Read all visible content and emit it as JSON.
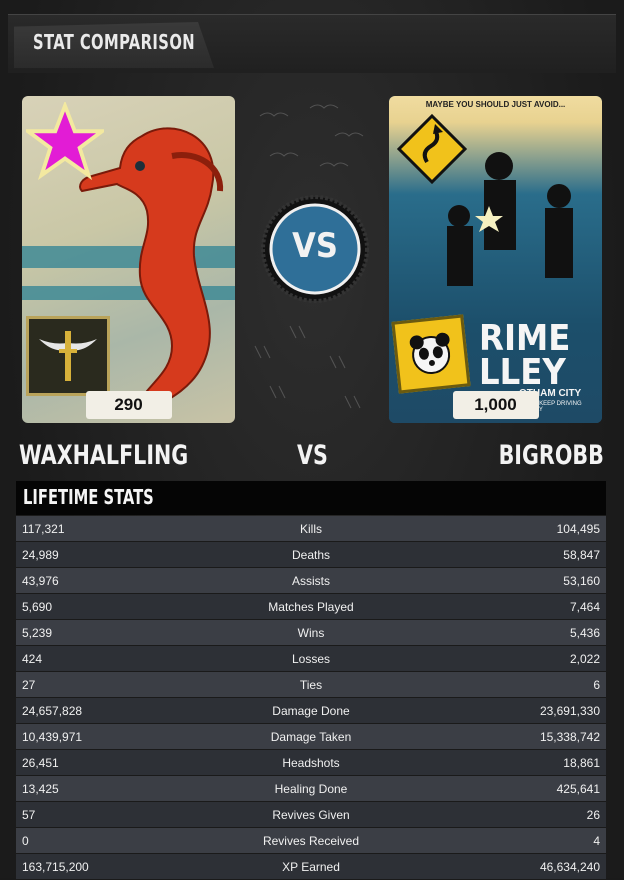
{
  "header": {
    "title": "STAT COMPARISON"
  },
  "player_left": {
    "name": "WAXHALFLING",
    "score": "290",
    "card_art": "red seahorse card",
    "badge": "winged sword"
  },
  "versus": {
    "label": "VS",
    "badge_text": "VS"
  },
  "player_right": {
    "name": "BIGROBB",
    "score": "1,000",
    "card_art": "crime alley poster",
    "poster_top": "MAYBE YOU SHOULD JUST AVOID...",
    "poster_word1": "RIME",
    "poster_word2": "LLEY",
    "poster_sub": "OTHAM CITY",
    "poster_small": "BUT JUST KEEP DRIVING SERIOUSLY"
  },
  "stats": {
    "title": "LIFETIME STATS",
    "rows": [
      {
        "left": "117,321",
        "label": "Kills",
        "right": "104,495"
      },
      {
        "left": "24,989",
        "label": "Deaths",
        "right": "58,847"
      },
      {
        "left": "43,976",
        "label": "Assists",
        "right": "53,160"
      },
      {
        "left": "5,690",
        "label": "Matches Played",
        "right": "7,464"
      },
      {
        "left": "5,239",
        "label": "Wins",
        "right": "5,436"
      },
      {
        "left": "424",
        "label": "Losses",
        "right": "2,022"
      },
      {
        "left": "27",
        "label": "Ties",
        "right": "6"
      },
      {
        "left": "24,657,828",
        "label": "Damage Done",
        "right": "23,691,330"
      },
      {
        "left": "10,439,971",
        "label": "Damage Taken",
        "right": "15,338,742"
      },
      {
        "left": "26,451",
        "label": "Headshots",
        "right": "18,861"
      },
      {
        "left": "13,425",
        "label": "Healing Done",
        "right": "425,641"
      },
      {
        "left": "57",
        "label": "Revives Given",
        "right": "26"
      },
      {
        "left": "0",
        "label": "Revives Received",
        "right": "4"
      },
      {
        "left": "163,715,200",
        "label": "XP Earned",
        "right": "46,634,240"
      }
    ]
  },
  "colors": {
    "vs_blue": "#2f6f98",
    "star_magenta": "#e21cd5",
    "seahorse_red": "#d63a1d",
    "poster_yellow": "#f1c21b"
  }
}
